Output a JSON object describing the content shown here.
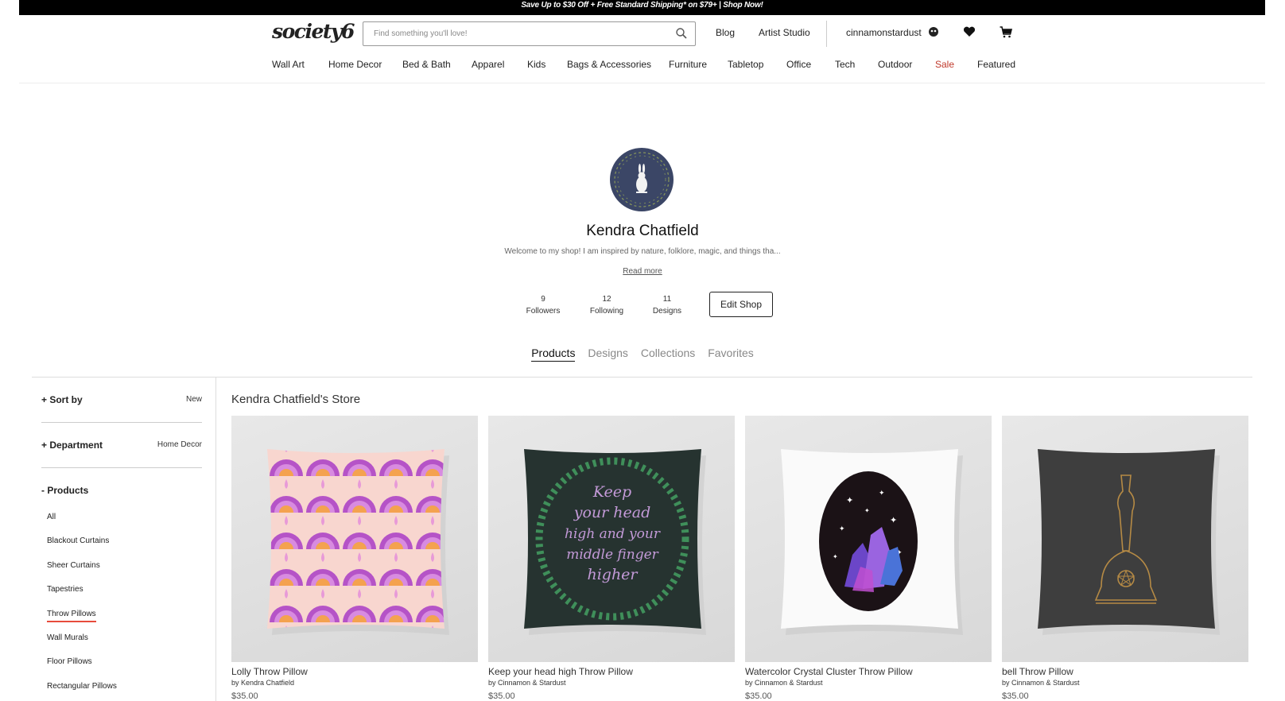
{
  "promo": "Save Up to $30 Off + Free Standard Shipping* on $79+ | Shop Now!",
  "header": {
    "logo": "society6",
    "search_placeholder": "Find something you'll love!",
    "blog": "Blog",
    "artist_studio": "Artist Studio",
    "username": "cinnamonstardust"
  },
  "nav": [
    "Wall Art",
    "Home Decor",
    "Bed & Bath",
    "Apparel",
    "Kids",
    "Bags & Accessories",
    "Furniture",
    "Tabletop",
    "Office",
    "Tech",
    "Outdoor",
    "Sale",
    "Featured"
  ],
  "profile": {
    "name": "Kendra Chatfield",
    "bio": "Welcome to my shop! I am inspired by nature, folklore, magic, and things tha...",
    "read_more": "Read more",
    "stats": [
      {
        "value": "9",
        "label": "Followers"
      },
      {
        "value": "12",
        "label": "Following"
      },
      {
        "value": "11",
        "label": "Designs"
      }
    ],
    "edit_shop": "Edit Shop"
  },
  "tabs": [
    "Products",
    "Designs",
    "Collections",
    "Favorites"
  ],
  "filters": {
    "sort_by": {
      "label": "+ Sort by",
      "value": "New"
    },
    "department": {
      "label": "+ Department",
      "value": "Home Decor"
    },
    "products": {
      "label": "- Products",
      "items": [
        "All",
        "Blackout Curtains",
        "Sheer Curtains",
        "Tapestries",
        "Throw Pillows",
        "Wall Murals",
        "Floor Pillows",
        "Rectangular Pillows"
      ],
      "selected": "Throw Pillows"
    }
  },
  "store": {
    "title": "Kendra Chatfield's Store",
    "products": [
      {
        "name": "Lolly Throw Pillow",
        "by": "by Kendra Chatfield",
        "price": "$35.00"
      },
      {
        "name": "Keep your head high Throw Pillow",
        "by": "by Cinnamon & Stardust",
        "price": "$35.00",
        "art_text": [
          "Keep",
          "your head",
          "high and your",
          "middle finger",
          "higher"
        ]
      },
      {
        "name": "Watercolor Crystal Cluster Throw Pillow",
        "by": "by Cinnamon & Stardust",
        "price": "$35.00"
      },
      {
        "name": "bell Throw Pillow",
        "by": "by Cinnamon & Stardust",
        "price": "$35.00"
      }
    ]
  },
  "colors": {
    "promo_bg": "#000000",
    "sale": "#c0392b",
    "avatar_bg": "#3b4666",
    "active_underline": "#e74c3c"
  }
}
